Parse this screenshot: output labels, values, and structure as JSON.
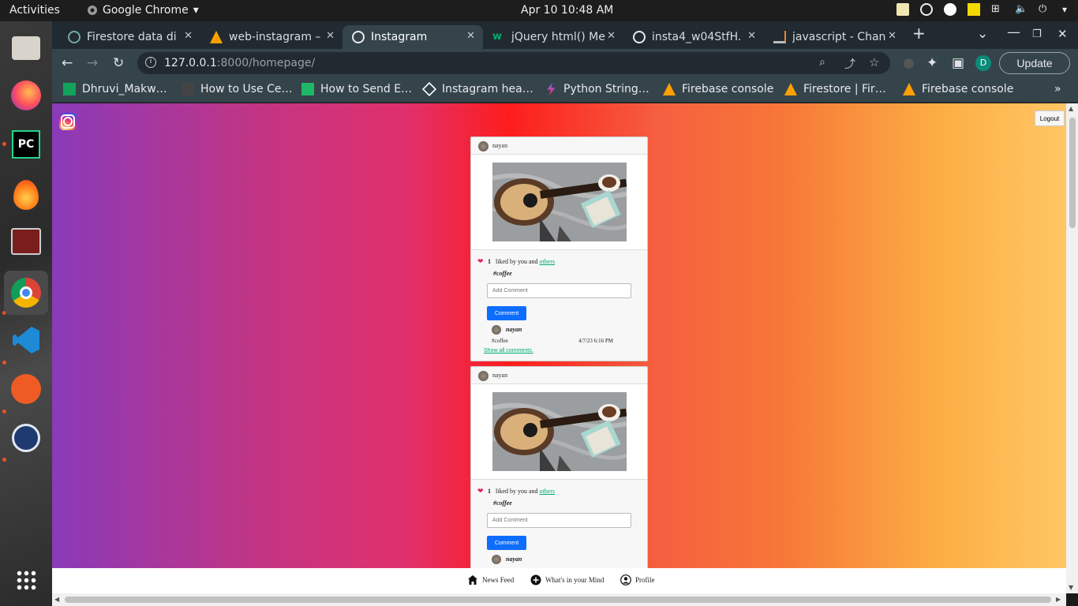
{
  "topbar": {
    "activities": "Activities",
    "app_name": "Google Chrome",
    "clock": "Apr 10  10:48 AM"
  },
  "tabs": [
    {
      "label": "Firestore data di",
      "icon": "openai-icon"
    },
    {
      "label": "web-instagram –",
      "icon": "firebase-icon"
    },
    {
      "label": "Instagram",
      "icon": "globe-icon",
      "active": true
    },
    {
      "label": "jQuery html() Me",
      "icon": "w3-icon"
    },
    {
      "label": "insta4_w04StfH.",
      "icon": "globe-icon"
    },
    {
      "label": "javascript - Chan",
      "icon": "stackoverflow-icon"
    }
  ],
  "toolbar": {
    "url_host": "127.0.0.1",
    "url_rest": ":8000/homepage/",
    "profile_initial": "D",
    "update_label": "Update"
  },
  "bookmarks": [
    {
      "label": "Dhruvi_Makw…"
    },
    {
      "label": "How to Use Ce…"
    },
    {
      "label": "How to Send E…"
    },
    {
      "label": "Instagram hea…"
    },
    {
      "label": "Python String…"
    },
    {
      "label": "Firebase console"
    },
    {
      "label": "Firestore | Fir…"
    },
    {
      "label": "Firebase console"
    }
  ],
  "page": {
    "logout_label": "Logout",
    "posts": [
      {
        "username": "nayan",
        "likes": "1",
        "liked_by_text": "liked by you and",
        "liked_by_link": "others",
        "caption": "#coffee",
        "comment_placeholder": "Add Comment",
        "comment_button": "Comment",
        "comment_user": "nayan",
        "comment_text": "#coffee",
        "comment_time": "4/7/23 6:16 PM",
        "show_all": "Show all comments."
      },
      {
        "username": "nayan",
        "likes": "1",
        "liked_by_text": "liked by you and",
        "liked_by_link": "others",
        "caption": "#coffee",
        "comment_placeholder": "Add Comment",
        "comment_button": "Comment",
        "comment_user": "nayan"
      }
    ],
    "nav": {
      "news_feed": "News Feed",
      "whats_in_mind": "What's in your Mind",
      "profile": "Profile"
    }
  },
  "colors": {
    "accent_button": "#0d6efd",
    "heart": "#e0245e",
    "link": "#00aa77"
  }
}
